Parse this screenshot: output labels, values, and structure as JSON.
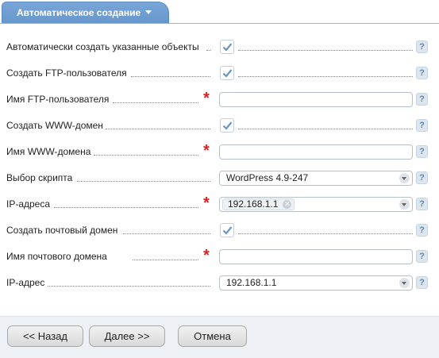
{
  "tab": {
    "label": "Автоматическое создание"
  },
  "help_label": "?",
  "form": {
    "auto_create_label": "Автоматически создать указанные объекты",
    "create_ftp_label": "Создать FTP-пользователя",
    "ftp_user_label": "Имя FTP-пользователя",
    "ftp_user_value": "",
    "create_www_label": "Создать WWW-домен",
    "www_domain_label": "Имя WWW-домена",
    "www_domain_value": "",
    "script_label": "Выбор скрипта",
    "script_value": "WordPress 4.9-247",
    "ip_label": "IP-адреса",
    "ip_tag": "192.168.1.1",
    "create_mail_label": "Создать почтовый домен",
    "mail_domain_label": "Имя почтового домена",
    "mail_domain_value": "",
    "ip_single_label": "IP-адрес",
    "ip_single_value": "192.168.1.1"
  },
  "checkboxes": {
    "auto_create": true,
    "create_ftp": true,
    "create_www": true,
    "create_mail": true
  },
  "buttons": {
    "back": "<< Назад",
    "next": "Далее >>",
    "cancel": "Отмена"
  },
  "colors": {
    "tab_bg": "#6f9dd2",
    "required": "#e02020",
    "check": "#6d95bd",
    "footer_bg": "#edf1f5"
  }
}
